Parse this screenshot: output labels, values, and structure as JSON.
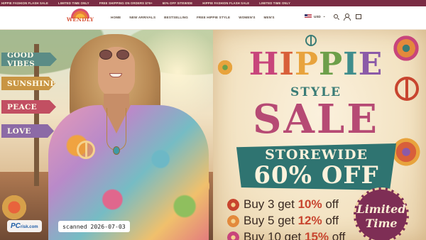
{
  "announcement": {
    "items": [
      "HIPPIE FASHION FLASH SALE",
      "LIMITED TIME ONLY",
      "FREE SHIPPING ON ORDERS $79+",
      "60% OFF SITEWIDE",
      "HIPPIE FASHION FLASH SALE",
      "LIMITED TIME ONLY"
    ]
  },
  "header": {
    "logo_text": "WENDLY",
    "nav": [
      "HOME",
      "NEW ARRIVALS",
      "BESTSELLING",
      "FREE HIPPIE STYLE",
      "WOMEN'S",
      "MEN'S"
    ],
    "currency": "USD",
    "icons": [
      "search-icon",
      "account-icon",
      "cart-icon"
    ]
  },
  "hero": {
    "signs": [
      "GOOD VIBES",
      "SUNSHINE",
      "PEACE",
      "LOVE"
    ],
    "headline": [
      "H",
      "I",
      "P",
      "P",
      "I",
      "E"
    ],
    "style_word": "STYLE",
    "sale_word": "SALE",
    "storewide": "STOREWIDE",
    "discount": "60% OFF",
    "offers": [
      {
        "prefix": "Buy 3 get ",
        "pct": "10%",
        "suffix": " off"
      },
      {
        "prefix": "Buy 5 get ",
        "pct": "12%",
        "suffix": " off"
      },
      {
        "prefix": "Buy 10 get ",
        "pct": "15%",
        "suffix": " off"
      }
    ],
    "badge": [
      "Limited",
      "Time"
    ]
  },
  "overlay": {
    "watermark_brand": "PC",
    "watermark_domain": "risk.com",
    "scan_stamp": "scanned 2026-07-03"
  },
  "colors": {
    "ticker_bg": "#7a2c44",
    "accent_teal": "#2f7471",
    "accent_magenta": "#b64a74"
  }
}
